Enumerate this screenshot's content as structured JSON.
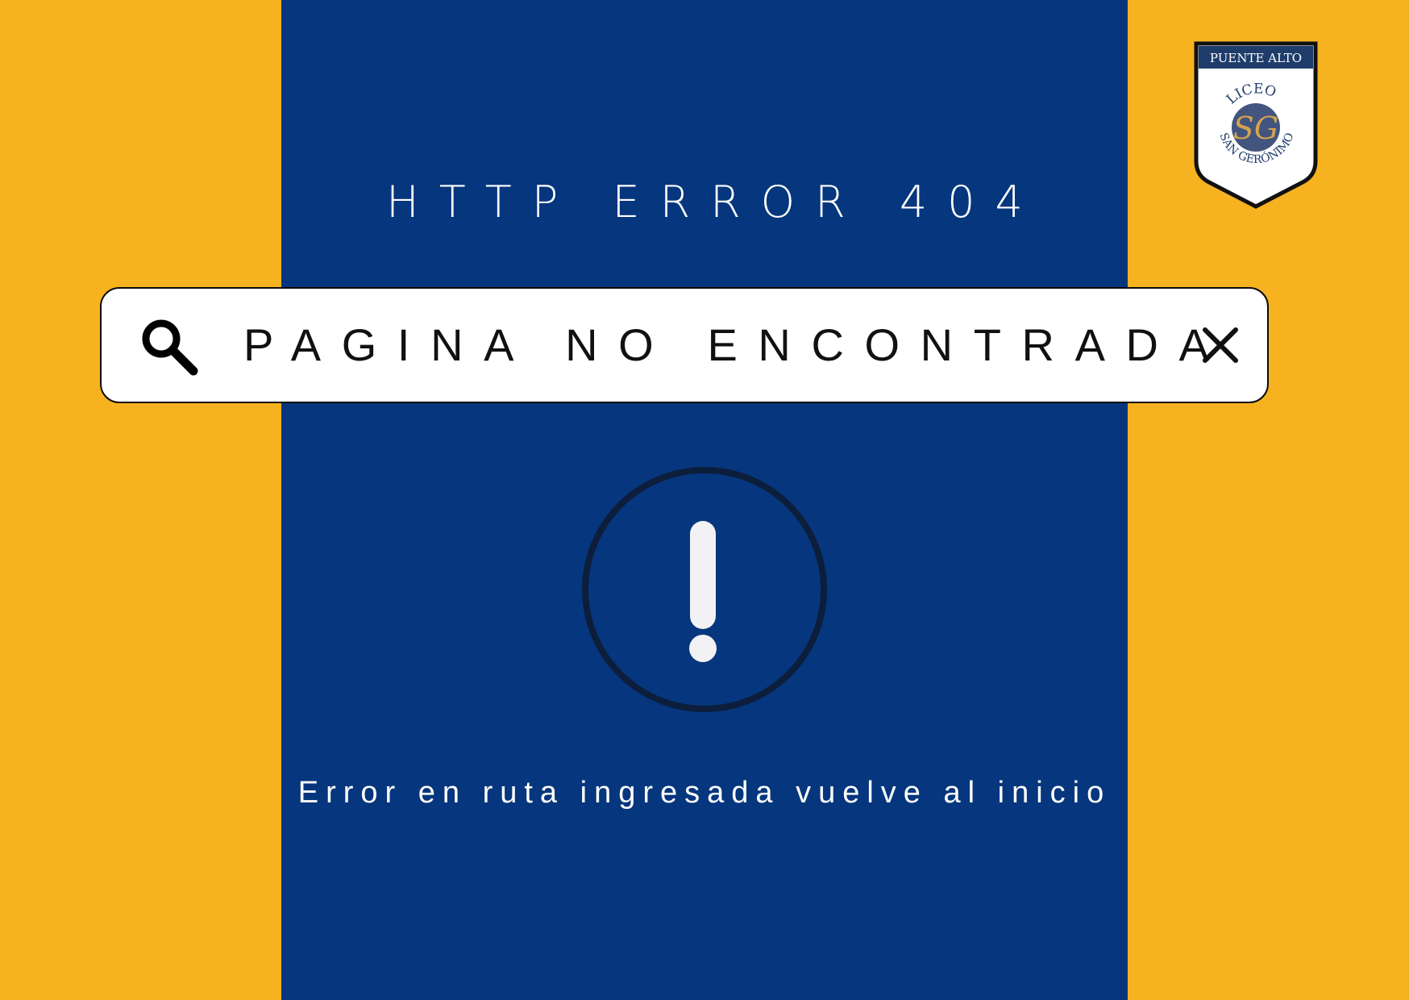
{
  "page": {
    "error_title": "HTTP ERROR 404",
    "message": "Error en ruta ingresada vuelve al inicio"
  },
  "search_bar": {
    "text": "PAGINA NO ENCONTRADA",
    "search_icon": "search-icon",
    "close_icon": "close-icon"
  },
  "alert": {
    "icon": "exclamation-icon"
  },
  "logo": {
    "top_text": "PUENTE ALTO",
    "name_top": "LICEO",
    "name_bottom": "SAN GERÓNIMO",
    "monogram": "SG"
  },
  "colors": {
    "background": "#F7B21F",
    "panel": "#06367D",
    "bar": "#FFFFFF",
    "text_dark": "#111111",
    "ring": "#0C1E3C"
  }
}
